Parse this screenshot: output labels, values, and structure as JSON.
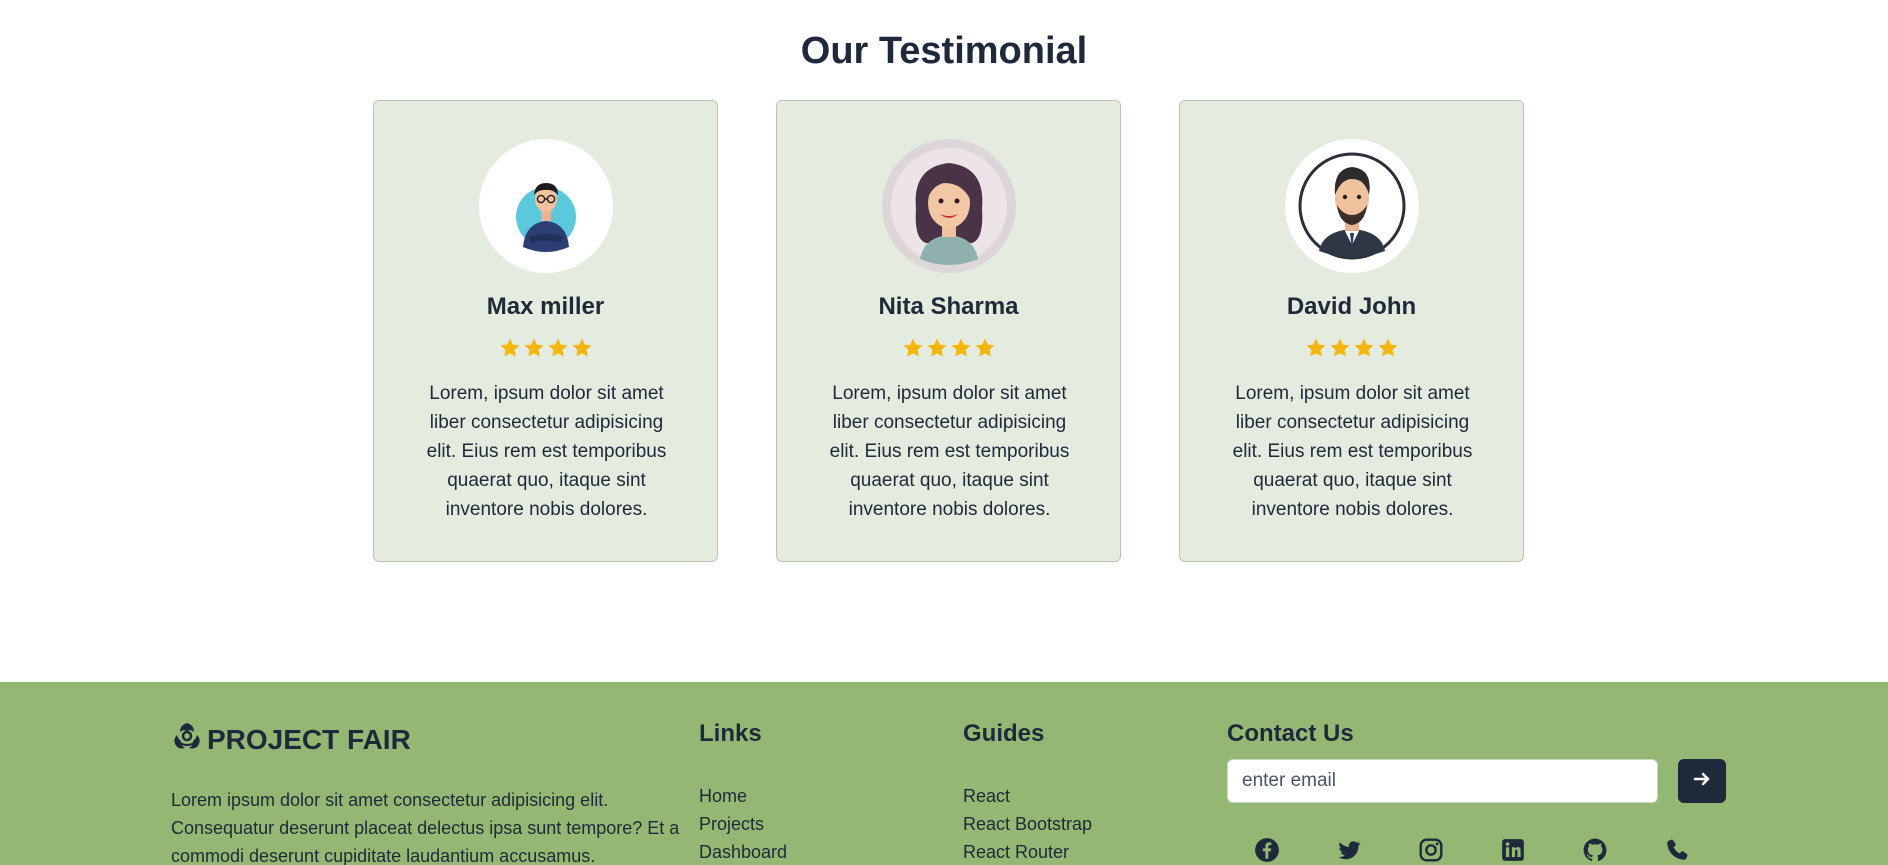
{
  "testimonials": {
    "title": "Our Testimonial",
    "cards": [
      {
        "name": "Max miller",
        "rating": 4,
        "quote": "Lorem, ipsum dolor sit amet liber consectetur adipisicing elit. Eius rem est temporibus quaerat quo, itaque sint inventore nobis dolores."
      },
      {
        "name": "Nita Sharma",
        "rating": 4,
        "quote": "Lorem, ipsum dolor sit amet liber consectetur adipisicing elit. Eius rem est temporibus quaerat quo, itaque sint inventore nobis dolores."
      },
      {
        "name": "David John",
        "rating": 4,
        "quote": "Lorem, ipsum dolor sit amet liber consectetur adipisicing elit. Eius rem est temporibus quaerat quo, itaque sint inventore nobis dolores."
      }
    ]
  },
  "footer": {
    "brand": "PROJECT FAIR",
    "brand_icon": "biohazard-icon",
    "about": "Lorem ipsum dolor sit amet consectetur adipisicing elit. Consequatur deserunt placeat delectus ipsa sunt tempore? Et a commodi deserunt cupiditate laudantium accusamus.",
    "links": {
      "title": "Links",
      "items": [
        "Home",
        "Projects",
        "Dashboard"
      ]
    },
    "guides": {
      "title": "Guides",
      "items": [
        "React",
        "React Bootstrap",
        "React Router"
      ]
    },
    "contact": {
      "title": "Contact Us",
      "email_placeholder": "enter email",
      "send_icon": "arrow-right-icon",
      "socials": [
        "facebook-icon",
        "twitter-icon",
        "instagram-icon",
        "linkedin-icon",
        "github-icon",
        "phone-icon"
      ]
    }
  },
  "colors": {
    "card_bg": "#e4ece0",
    "footer_bg": "#94b874",
    "star": "#f5b60a",
    "dark": "#1e293b"
  }
}
